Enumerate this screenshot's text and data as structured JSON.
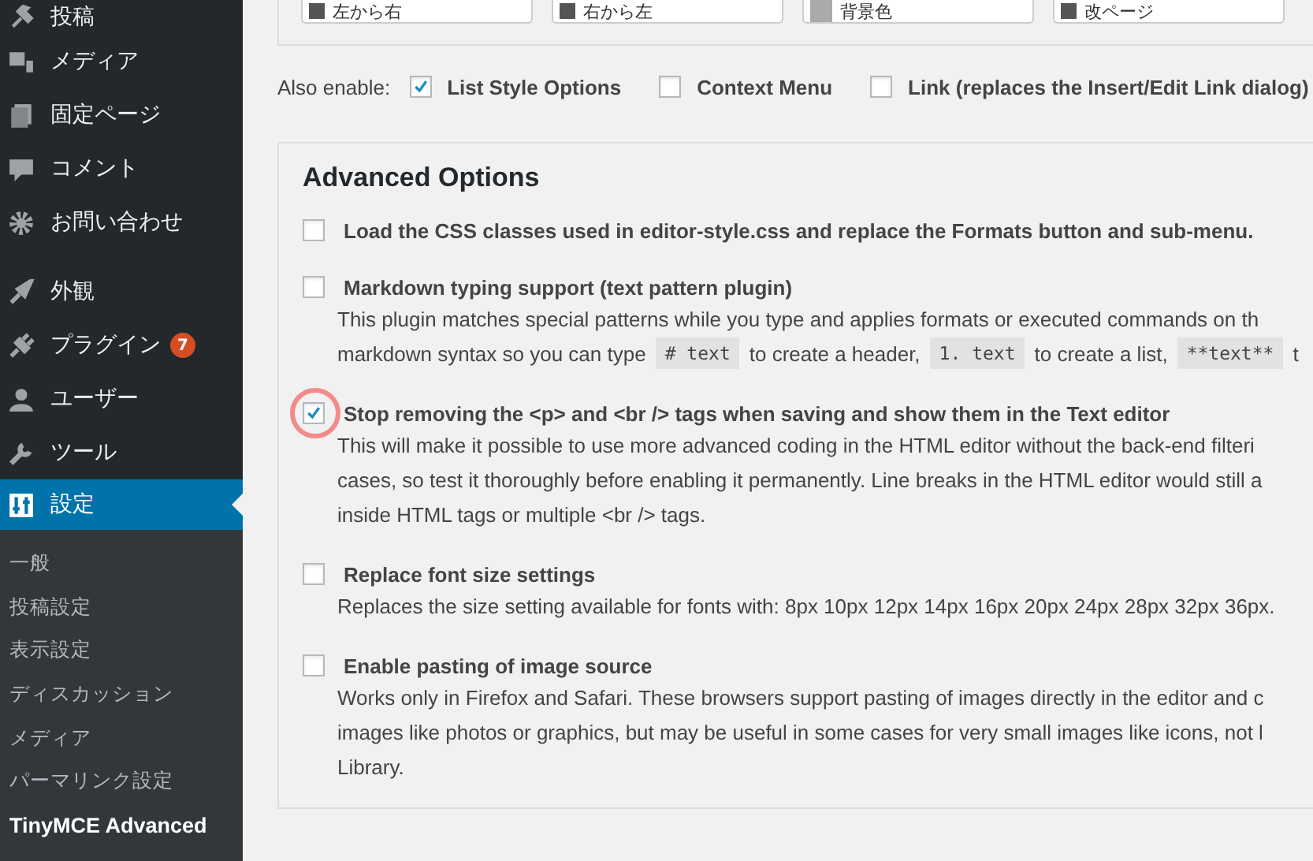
{
  "sidebar": {
    "items": [
      {
        "label": "投稿",
        "selected": false
      },
      {
        "label": "メディア",
        "selected": false
      },
      {
        "label": "固定ページ",
        "selected": false
      },
      {
        "label": "コメント",
        "selected": false
      },
      {
        "label": "お問い合わせ",
        "selected": false
      },
      {
        "label": "外観",
        "selected": false
      },
      {
        "label": "プラグイン",
        "selected": false,
        "badge": "7"
      },
      {
        "label": "ユーザー",
        "selected": false
      },
      {
        "label": "ツール",
        "selected": false
      },
      {
        "label": "設定",
        "selected": true
      }
    ],
    "submenu": [
      {
        "label": "一般",
        "selected": false
      },
      {
        "label": "投稿設定",
        "selected": false
      },
      {
        "label": "表示設定",
        "selected": false
      },
      {
        "label": "ディスカッション",
        "selected": false
      },
      {
        "label": "メディア",
        "selected": false
      },
      {
        "label": "パーマリンク設定",
        "selected": false
      },
      {
        "label": "TinyMCE Advanced",
        "selected": true
      }
    ]
  },
  "toolbar_buttons": [
    {
      "label": "左から右"
    },
    {
      "label": "右から左"
    },
    {
      "label": "背景色"
    },
    {
      "label": "改ページ"
    }
  ],
  "also_enable": {
    "label": "Also enable:",
    "options": [
      {
        "label": "List Style Options",
        "checked": true
      },
      {
        "label": "Context Menu",
        "checked": false
      },
      {
        "label": "Link (replaces the Insert/Edit Link dialog)",
        "checked": false
      }
    ]
  },
  "advanced": {
    "title": "Advanced Options",
    "options": [
      {
        "label": "Load the CSS classes used in editor-style.css and replace the Formats button and sub-menu.",
        "checked": false,
        "highlighted": false
      },
      {
        "label": "Markdown typing support (text pattern plugin)",
        "checked": false,
        "highlighted": false,
        "description": [
          [
            {
              "kind": "text",
              "text": "This plugin matches special patterns while you type and applies formats or executed commands on th"
            }
          ],
          [
            {
              "kind": "text",
              "text": "markdown syntax so you can type"
            },
            {
              "kind": "code",
              "text": "# text"
            },
            {
              "kind": "text",
              "text": "to create a header,"
            },
            {
              "kind": "code",
              "text": "1. text"
            },
            {
              "kind": "text",
              "text": "to create a list,"
            },
            {
              "kind": "code",
              "text": "**text**"
            },
            {
              "kind": "text",
              "text": "t"
            }
          ]
        ]
      },
      {
        "label": "Stop removing the <p> and <br /> tags when saving and show them in the Text editor",
        "checked": true,
        "highlighted": true,
        "description": [
          [
            {
              "kind": "text",
              "text": "This will make it possible to use more advanced coding in the HTML editor without the back-end filteri"
            }
          ],
          [
            {
              "kind": "text",
              "text": "cases, so test it thoroughly before enabling it permanently. Line breaks in the HTML editor would still a"
            }
          ],
          [
            {
              "kind": "text",
              "text": "inside HTML tags or multiple <br /> tags."
            }
          ]
        ]
      },
      {
        "label": "Replace font size settings",
        "checked": false,
        "highlighted": false,
        "description": [
          [
            {
              "kind": "text",
              "text": "Replaces the size setting available for fonts with: 8px 10px 12px 14px 16px 20px 24px 28px 32px 36px."
            }
          ]
        ]
      },
      {
        "label": "Enable pasting of image source",
        "checked": false,
        "highlighted": false,
        "description": [
          [
            {
              "kind": "text",
              "text": "Works only in Firefox and Safari. These browsers support pasting of images directly in the editor and c"
            }
          ],
          [
            {
              "kind": "text",
              "text": "images like photos or graphics, but may be useful in some cases for very small images like icons, not l"
            }
          ],
          [
            {
              "kind": "text",
              "text": "Library."
            }
          ]
        ]
      }
    ]
  }
}
